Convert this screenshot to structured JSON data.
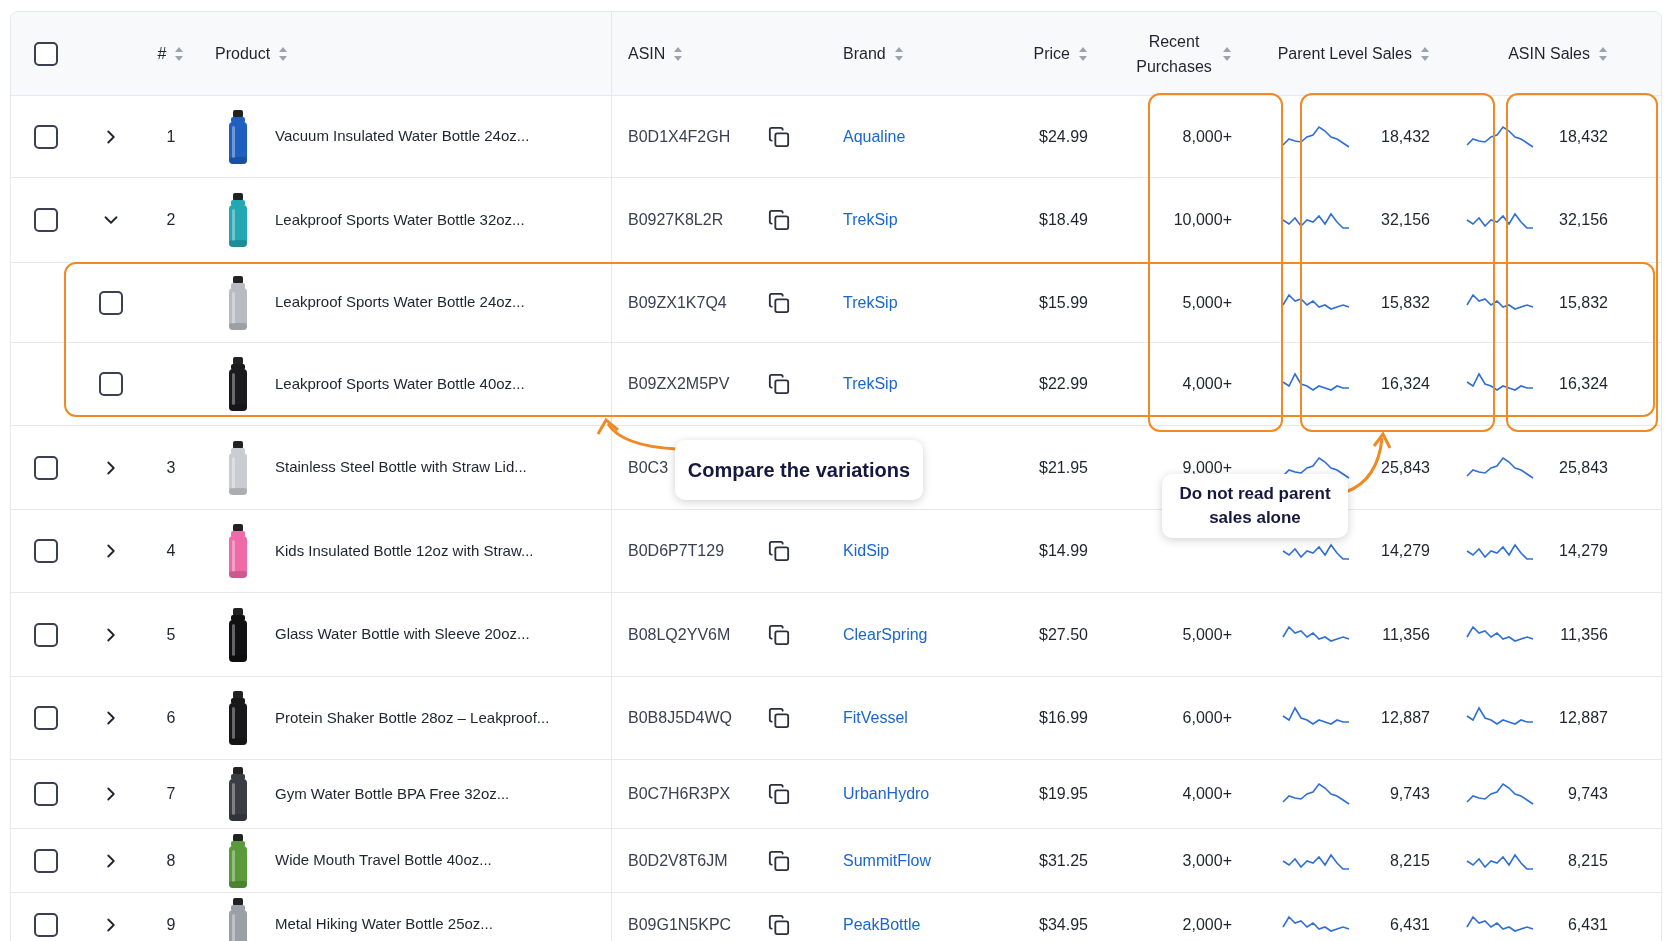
{
  "table": {
    "select_all": {
      "checked": false
    },
    "columns": [
      {
        "label": "#"
      },
      {
        "label": "Product"
      },
      {
        "label": "ASIN"
      },
      {
        "label": "Brand"
      },
      {
        "label": "Price"
      },
      {
        "label": "Recent Purchases"
      },
      {
        "label": "Parent Level Sales"
      },
      {
        "label": "ASIN Sales"
      }
    ],
    "rows": [
      {
        "checked": false,
        "expanded": false,
        "index": "1",
        "product": "Vacuum Insulated Water Bottle 24oz...",
        "asin": "B0D1X4F2GH",
        "copy": true,
        "brand": "Aqualine",
        "price": "$24.99",
        "recent_purchases": "8,000+",
        "parent_sales": "18,432",
        "asin_sales": "18,432"
      },
      {
        "checked": false,
        "expanded": true,
        "index": "2",
        "product": "Leakproof Sports Water Bottle 32oz...",
        "asin": "B0927K8L2R",
        "copy": true,
        "brand": "TrekSip",
        "price": "$18.49",
        "recent_purchases": "10,000+",
        "parent_sales": "32,156",
        "asin_sales": "32,156",
        "children": [
          {
            "checked": false,
            "product": "Leakproof Sports Water Bottle 24oz...",
            "asin": "B09ZX1K7Q4",
            "copy": true,
            "brand": "TrekSip",
            "price": "$15.99",
            "recent_purchases": "5,000+",
            "parent_sales": "15,832",
            "asin_sales": "15,832"
          },
          {
            "checked": false,
            "product": "Leakproof Sports Water Bottle 40oz...",
            "asin": "B09ZX2M5PV",
            "copy": true,
            "brand": "TrekSip",
            "price": "$22.99",
            "recent_purchases": "4,000+",
            "parent_sales": "16,324",
            "asin_sales": "16,324"
          }
        ]
      },
      {
        "checked": false,
        "expanded": false,
        "index": "3",
        "product": "Stainless Steel Bottle with Straw Lid...",
        "asin": "B0C3",
        "copy": false,
        "price": "$21.95",
        "recent_purchases": "9,000+",
        "parent_sales": "25,843",
        "asin_sales": "25,843"
      },
      {
        "checked": false,
        "expanded": false,
        "index": "4",
        "product": "Kids Insulated Bottle 12oz with Straw...",
        "asin": "B0D6P7T129",
        "copy": true,
        "brand": "KidSip",
        "price": "$14.99",
        "parent_sales": "14,279",
        "asin_sales": "14,279"
      },
      {
        "checked": false,
        "expanded": false,
        "index": "5",
        "product": "Glass Water Bottle with Sleeve 20oz...",
        "asin": "B08LQ2YV6M",
        "copy": true,
        "brand": "ClearSpring",
        "price": "$27.50",
        "recent_purchases": "5,000+",
        "parent_sales": "11,356",
        "asin_sales": "11,356"
      },
      {
        "checked": false,
        "expanded": false,
        "index": "6",
        "product": "Protein Shaker Bottle 28oz – Leakproof...",
        "asin": "B0B8J5D4WQ",
        "copy": true,
        "brand": "FitVessel",
        "price": "$16.99",
        "recent_purchases": "6,000+",
        "parent_sales": "12,887",
        "asin_sales": "12,887"
      },
      {
        "checked": false,
        "expanded": false,
        "index": "7",
        "product": "Gym Water Bottle BPA Free 32oz...",
        "asin": "B0C7H6R3PX",
        "copy": true,
        "brand": "UrbanHydro",
        "price": "$19.95",
        "recent_purchases": "4,000+",
        "parent_sales": "9,743",
        "asin_sales": "9,743"
      },
      {
        "checked": false,
        "expanded": false,
        "index": "8",
        "product": "Wide Mouth Travel Bottle 40oz...",
        "asin": "B0D2V8T6JM",
        "copy": true,
        "brand": "SummitFlow",
        "price": "$31.25",
        "recent_purchases": "3,000+",
        "parent_sales": "8,215",
        "asin_sales": "8,215"
      },
      {
        "checked": false,
        "expanded": false,
        "index": "9",
        "product": "Metal Hiking Water Bottle 25oz...",
        "asin": "B09G1N5KPC",
        "copy": true,
        "brand": "PeakBottle",
        "price": "$34.95",
        "recent_purchases": "2,000+",
        "parent_sales": "6,431",
        "asin_sales": "6,431"
      }
    ]
  },
  "callouts": [
    {
      "text": "Compare the variations"
    },
    {
      "text": "Do not read parent sales alone"
    }
  ]
}
